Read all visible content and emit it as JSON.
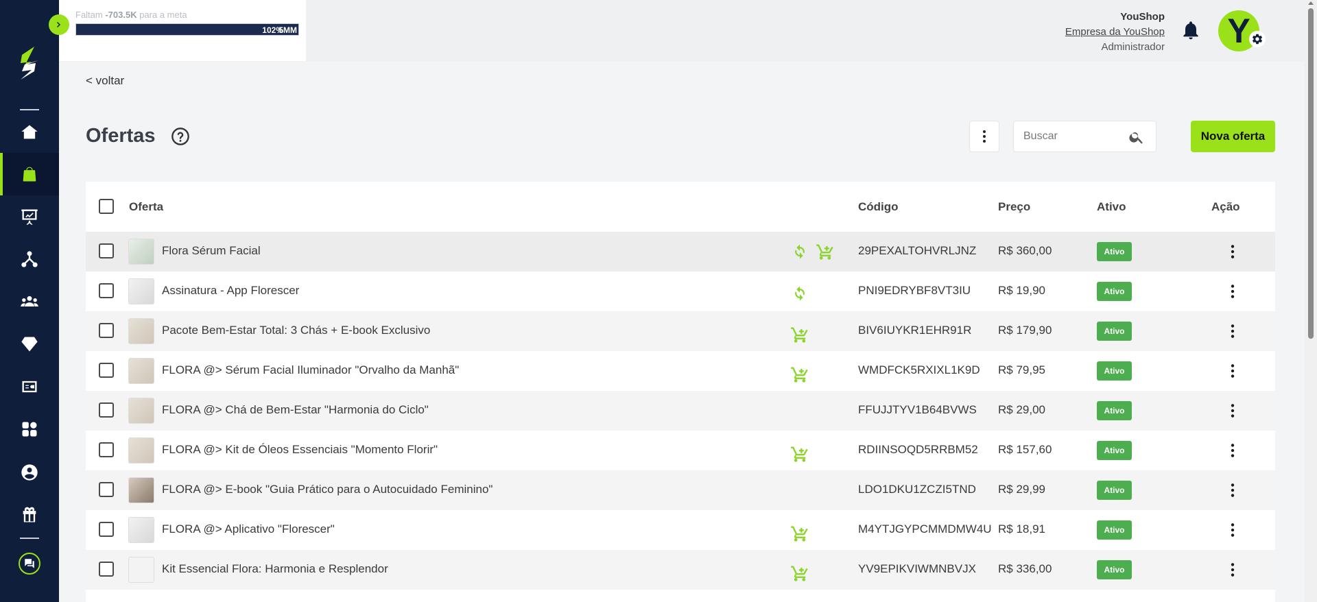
{
  "sidebar": {
    "items": [
      {
        "name": "home-icon"
      },
      {
        "name": "shopping-bag-icon",
        "active": true
      },
      {
        "name": "presentation-chart-icon"
      },
      {
        "name": "network-icon"
      },
      {
        "name": "users-icon"
      },
      {
        "name": "diamond-icon"
      },
      {
        "name": "wallet-icon"
      },
      {
        "name": "apps-grid-icon"
      },
      {
        "name": "account-circle-icon"
      },
      {
        "name": "gift-icon"
      }
    ],
    "accent": "#9be11a",
    "background": "#0f1e3a"
  },
  "goal": {
    "text_prefix": "Faltam ",
    "amount": "-703.5K",
    "text_suffix": " para a meta",
    "percent": "102%",
    "target": "5MM",
    "progress": 1.0
  },
  "user": {
    "company": "YouShop",
    "org": "Empresa da YouShop",
    "role": "Administrador",
    "avatar_letter": "Y"
  },
  "page": {
    "back": "< voltar",
    "title": "Ofertas",
    "search_placeholder": "Buscar",
    "new_button": "Nova oferta"
  },
  "table": {
    "headers": {
      "offer": "Oferta",
      "code": "Código",
      "price": "Preço",
      "active": "Ativo",
      "action": "Ação"
    },
    "rows": [
      {
        "name": "Flora Sérum Facial",
        "code": "29PEXALTOHVRLJNZ",
        "price": "R$ 360,00",
        "status": "Ativo",
        "recurring": true,
        "cart": true,
        "thumb": "teal"
      },
      {
        "name": "Assinatura - App Florescer",
        "code": "PNI9EDRYBF8VT3IU",
        "price": "R$ 19,90",
        "status": "Ativo",
        "recurring": true,
        "cart": false,
        "thumb": "phone"
      },
      {
        "name": "Pacote Bem-Estar Total: 3 Chás + E-book Exclusivo",
        "code": "BIV6IUYKR1EHR91R",
        "price": "R$ 179,90",
        "status": "Ativo",
        "recurring": false,
        "cart": true,
        "thumb": "beige"
      },
      {
        "name": "FLORA @> Sérum Facial Iluminador \"Orvalho da Manhã\"",
        "code": "WMDFCK5RXIXL1K9D",
        "price": "R$ 79,95",
        "status": "Ativo",
        "recurring": false,
        "cart": true,
        "thumb": "beige"
      },
      {
        "name": "FLORA @> Chá de Bem-Estar \"Harmonia do Ciclo\"",
        "code": "FFUJJTYV1B64BVWS",
        "price": "R$ 29,00",
        "status": "Ativo",
        "recurring": false,
        "cart": false,
        "thumb": "beige"
      },
      {
        "name": "FLORA @> Kit de Óleos Essenciais \"Momento Florir\"",
        "code": "RDIINSOQD5RRBM52",
        "price": "R$ 157,60",
        "status": "Ativo",
        "recurring": false,
        "cart": true,
        "thumb": "beige"
      },
      {
        "name": "FLORA @> E-book \"Guia Prático para o Autocuidado Feminino\"",
        "code": "LDO1DKU1ZCZI5TND",
        "price": "R$ 29,99",
        "status": "Ativo",
        "recurring": false,
        "cart": false,
        "thumb": "dark"
      },
      {
        "name": "FLORA @> Aplicativo \"Florescer\"",
        "code": "M4YTJGYPCMMDMW4U",
        "price": "R$ 18,91",
        "status": "Ativo",
        "recurring": false,
        "cart": true,
        "thumb": "phone"
      },
      {
        "name": "Kit Essencial Flora: Harmonia e Resplendor",
        "code": "YV9EPIKVIWMNBVJX",
        "price": "R$ 336,00",
        "status": "Ativo",
        "recurring": false,
        "cart": true,
        "thumb": "blank"
      }
    ]
  }
}
